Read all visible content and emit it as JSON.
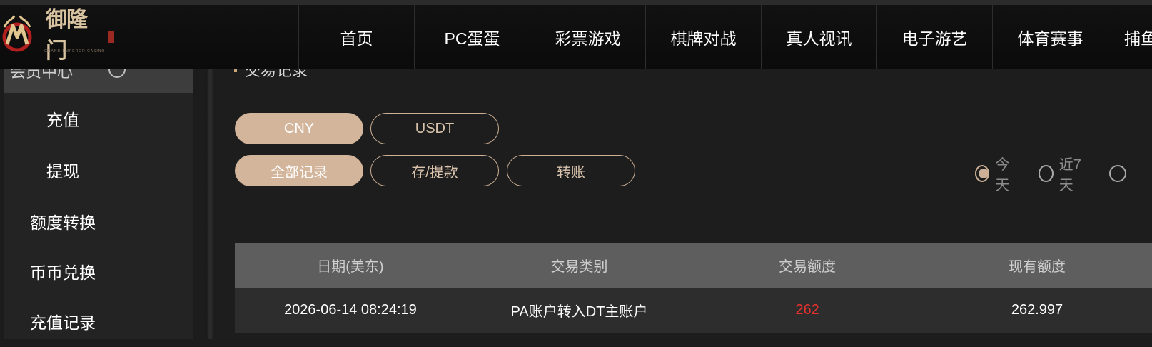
{
  "header": {
    "logo_text": "御隆门",
    "logo_subtext": "GRAND EMPEROR CASINO",
    "nav": [
      "首页",
      "PC蛋蛋",
      "彩票游戏",
      "棋牌对战",
      "真人视讯",
      "电子游艺",
      "体育赛事",
      "捕鱼"
    ]
  },
  "sidebar": {
    "header_label": "会员中心",
    "items": [
      "充值",
      "提现",
      "额度转换",
      "币币兑换",
      "充值记录"
    ]
  },
  "main": {
    "title": "交易记录",
    "currency_tabs": [
      "CNY",
      "USDT"
    ],
    "active_currency": "CNY",
    "record_tabs": [
      "全部记录",
      "存/提款",
      "转账"
    ],
    "active_record": "全部记录",
    "date_filters": [
      {
        "label": "今天",
        "checked": true
      },
      {
        "label": "近7天",
        "checked": false
      },
      {
        "label": "",
        "checked": false
      }
    ]
  },
  "table": {
    "headers": [
      "日期(美东)",
      "交易类别",
      "交易额度",
      "现有额度"
    ],
    "rows": [
      {
        "date": "2026-06-14 08:24:19",
        "type": "PA账户转入DT主账户",
        "amount": "262",
        "balance": "262.997"
      }
    ]
  },
  "colors": {
    "accent": "#d3b59b",
    "negative": "#e8312d",
    "background": "#1c1c1c"
  }
}
